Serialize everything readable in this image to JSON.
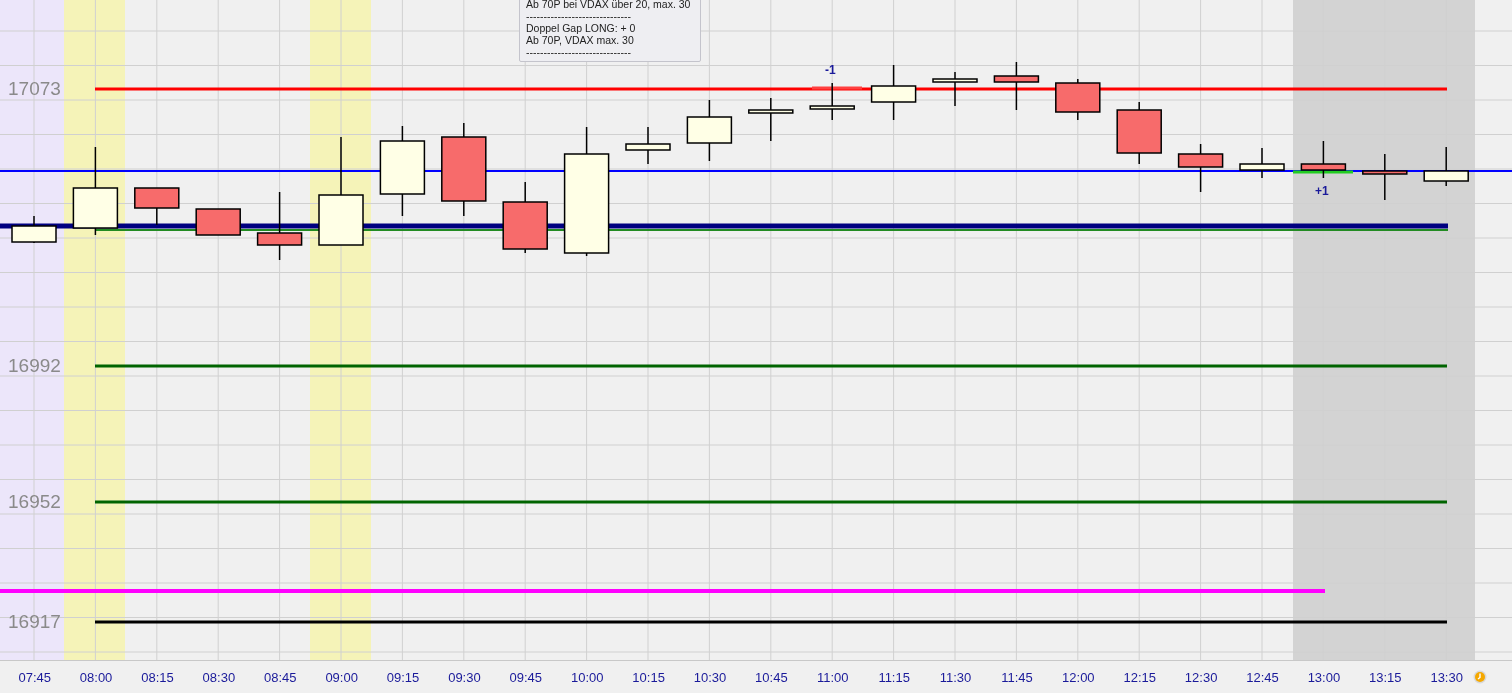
{
  "tooltip": {
    "lines": [
      "Ab 70P bei VDAX über 20, max. 30",
      "------------------------------",
      "Doppel Gap LONG: + 0",
      "Ab 70P, VDAX max. 30",
      "------------------------------"
    ]
  },
  "price_labels": [
    "17073",
    "16992",
    "16952",
    "16917"
  ],
  "level_lines": [
    {
      "color": "#ff0000"
    },
    {
      "color": "#0000ff"
    },
    {
      "color": "#000080"
    },
    {
      "color": "#228b22"
    },
    {
      "color": "#006400"
    },
    {
      "color": "#006400"
    },
    {
      "color": "#ff00ff"
    },
    {
      "color": "#000000"
    },
    {
      "color": "#ff4040"
    },
    {
      "color": "#22cc22"
    }
  ],
  "trade_markers": [
    "-1",
    "+1"
  ],
  "time_axis": [
    "07:45",
    "08:00",
    "08:15",
    "08:30",
    "08:45",
    "09:00",
    "09:15",
    "09:30",
    "09:45",
    "10:00",
    "10:15",
    "10:30",
    "10:45",
    "11:00",
    "11:15",
    "11:30",
    "11:45",
    "12:00",
    "12:15",
    "12:30",
    "12:45",
    "13:00",
    "13:15",
    "13:30"
  ]
}
